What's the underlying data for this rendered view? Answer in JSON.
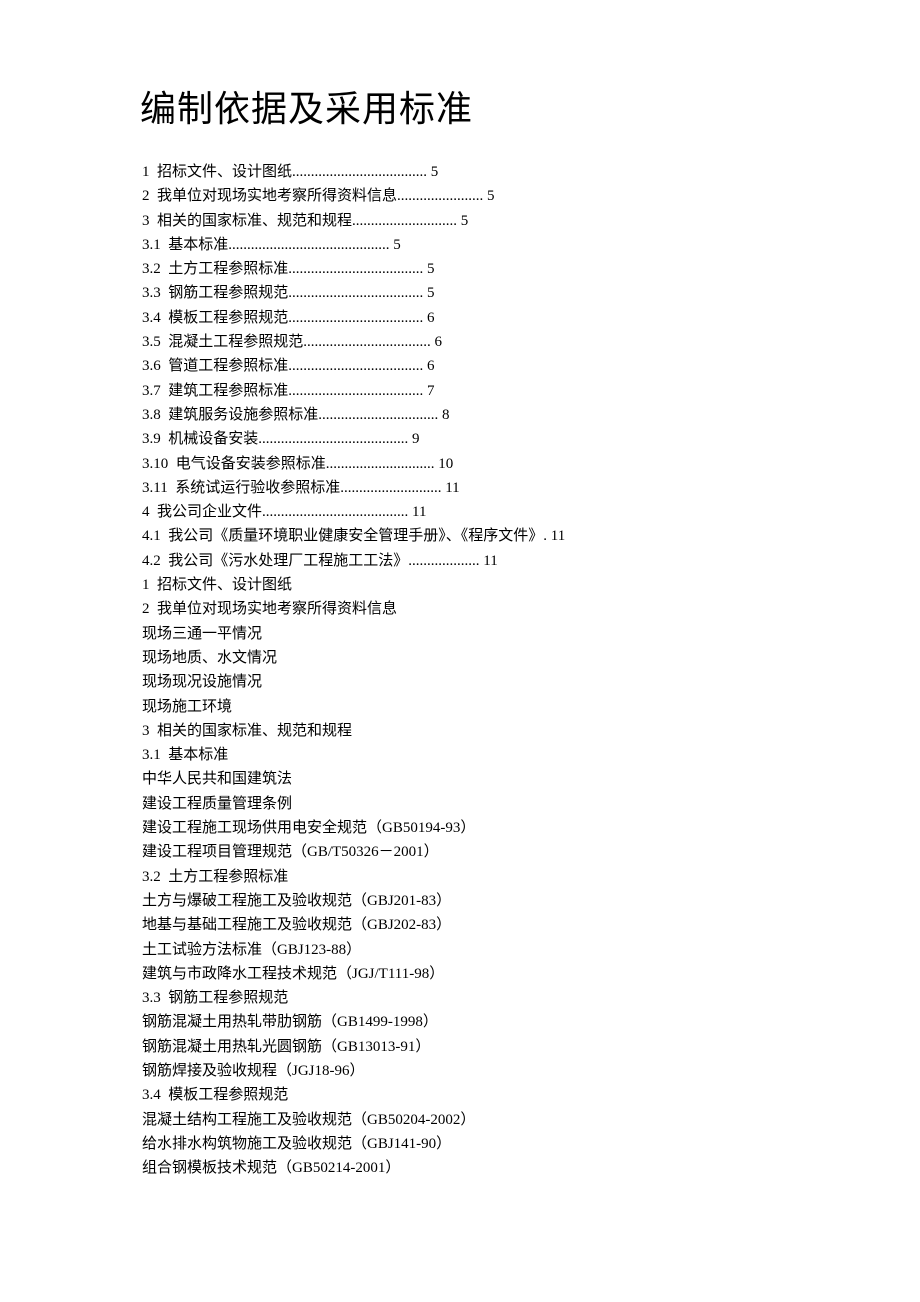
{
  "title": "编制依据及采用标准",
  "lines": [
    "1  招标文件、设计图纸.................................... 5",
    "2  我单位对现场实地考察所得资料信息....................... 5",
    "3  相关的国家标准、规范和规程............................ 5",
    "3.1  基本标准........................................... 5",
    "3.2  土方工程参照标准.................................... 5",
    "3.3  钢筋工程参照规范.................................... 5",
    "3.4  模板工程参照规范.................................... 6",
    "3.5  混凝土工程参照规范.................................. 6",
    "3.6  管道工程参照标准.................................... 6",
    "3.7  建筑工程参照标准.................................... 7",
    "3.8  建筑服务设施参照标准................................ 8",
    "3.9  机械设备安装........................................ 9",
    "3.10  电气设备安装参照标准............................. 10",
    "3.11  系统试运行验收参照标准........................... 11",
    "4  我公司企业文件....................................... 11",
    "4.1  我公司《质量环境职业健康安全管理手册》、《程序文件》. 11",
    "4.2  我公司《污水处理厂工程施工工法》................... 11",
    "1  招标文件、设计图纸",
    "2  我单位对现场实地考察所得资料信息",
    "现场三通一平情况",
    "现场地质、水文情况",
    "现场现况设施情况",
    "现场施工环境",
    "3  相关的国家标准、规范和规程",
    "3.1  基本标准",
    "中华人民共和国建筑法",
    "建设工程质量管理条例",
    "建设工程施工现场供用电安全规范（GB50194-93）",
    "建设工程项目管理规范（GB/T50326－2001）",
    "3.2  土方工程参照标准",
    "土方与爆破工程施工及验收规范（GBJ201-83）",
    "地基与基础工程施工及验收规范（GBJ202-83）",
    "土工试验方法标准（GBJ123-88）",
    "建筑与市政降水工程技术规范（JGJ/T111-98）",
    "3.3  钢筋工程参照规范",
    "钢筋混凝土用热轧带肋钢筋（GB1499-1998）",
    "钢筋混凝土用热轧光圆钢筋（GB13013-91）",
    "钢筋焊接及验收规程（JGJ18-96）",
    "3.4  模板工程参照规范",
    "混凝土结构工程施工及验收规范（GB50204-2002）",
    "给水排水构筑物施工及验收规范（GBJ141-90）",
    "组合钢模板技术规范（GB50214-2001）"
  ]
}
